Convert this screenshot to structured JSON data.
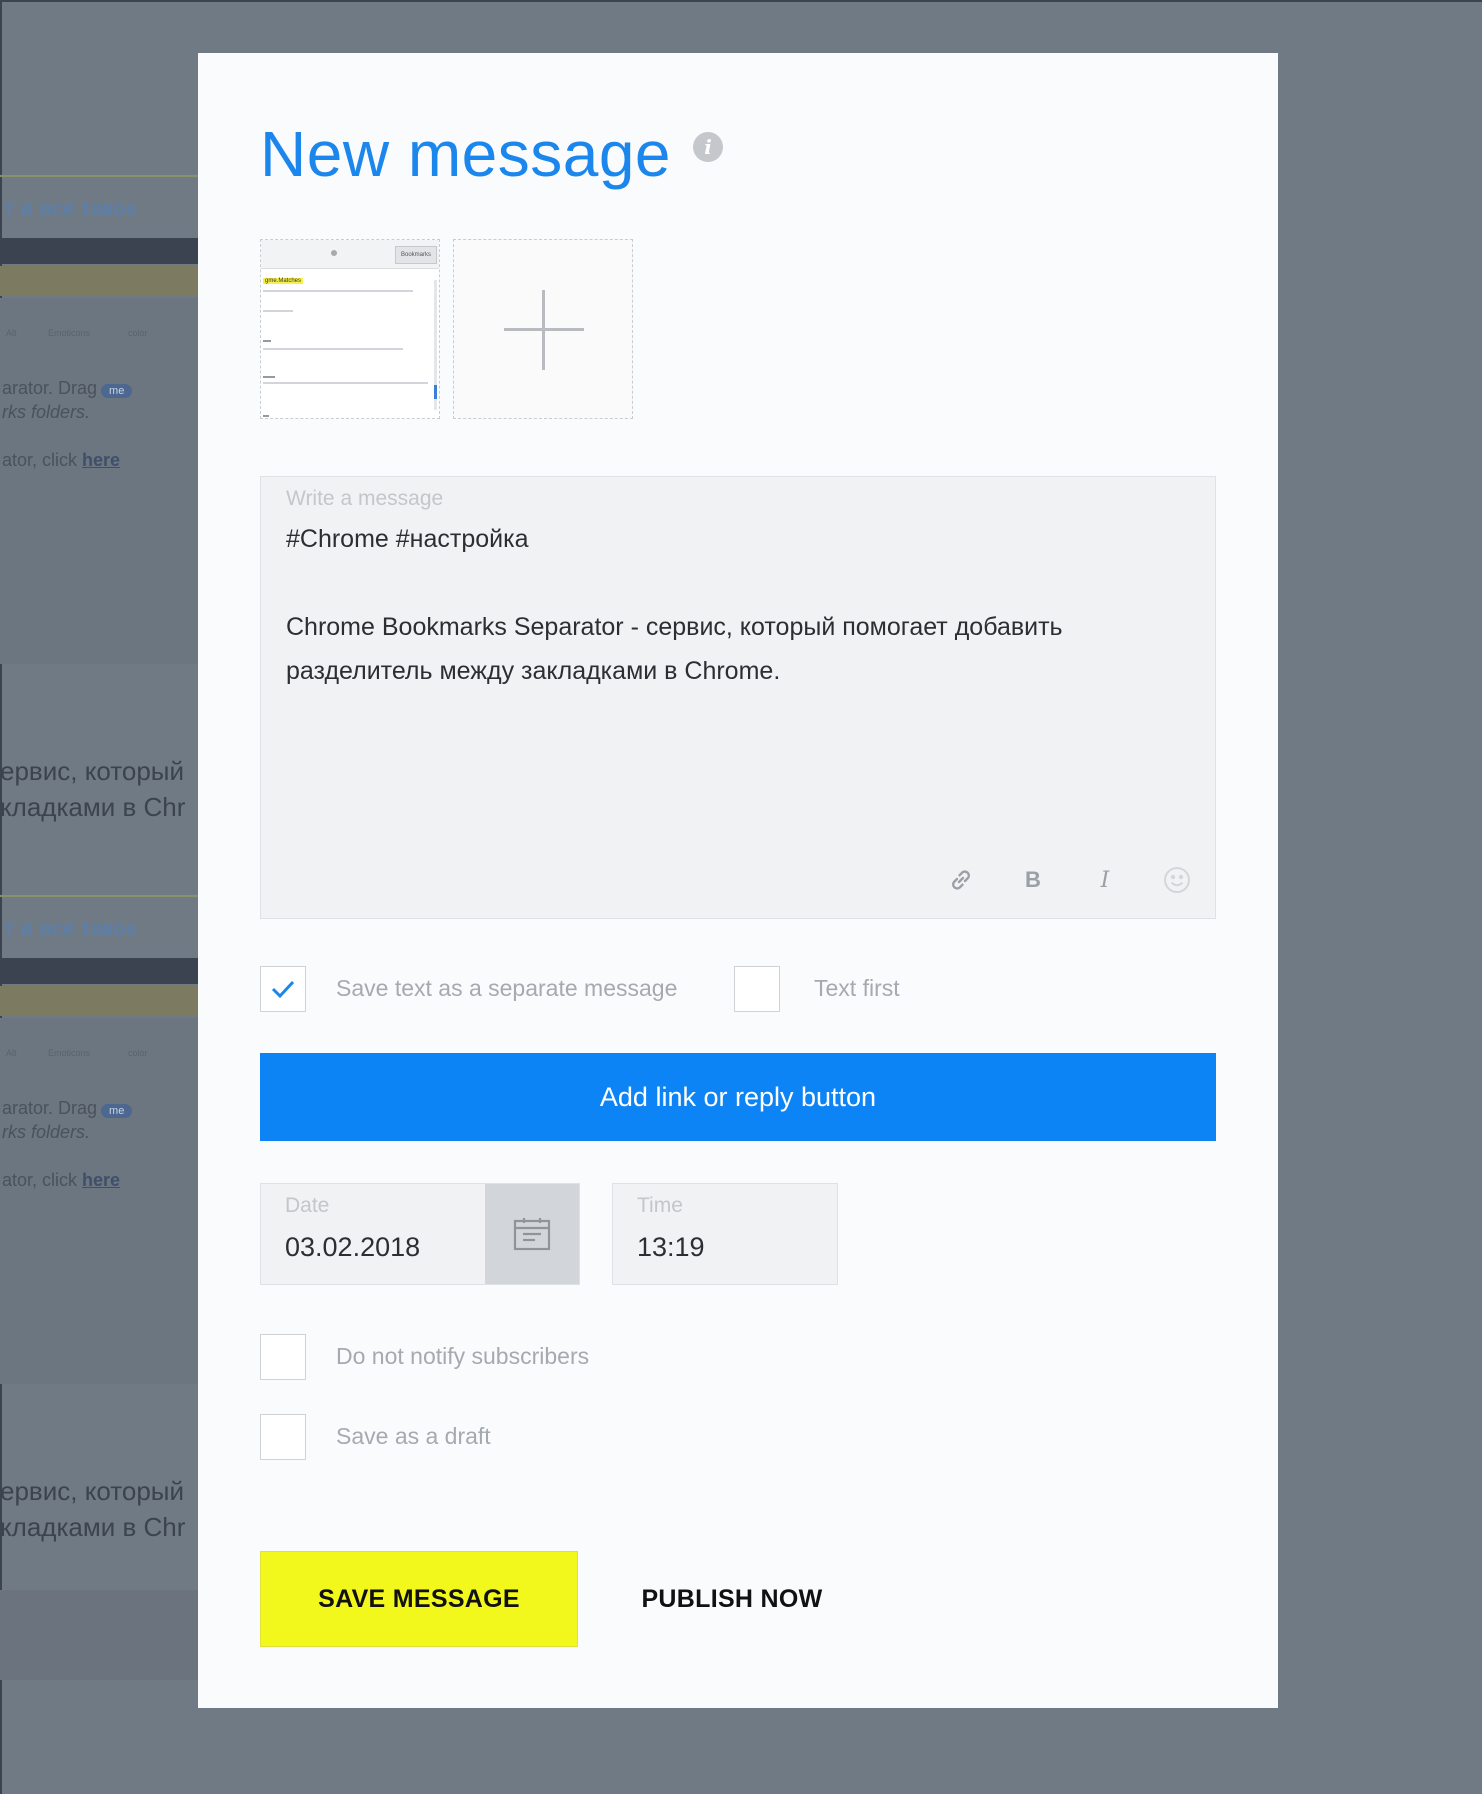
{
  "background": {
    "tagline": "т и все такое",
    "row1_text": "arator. Drag",
    "badge": "me",
    "row2_text": "rks folders.",
    "row3_text": "ator, click ",
    "row3_link": "here",
    "snippet_line1": "ервис, который",
    "snippet_line2": "кладками в Chr",
    "tiny_labels": [
      "Alt",
      "Emoticons",
      "color"
    ]
  },
  "modal": {
    "title": "New message",
    "info_icon": "i",
    "thumbnail_highlight": "gme.Matches",
    "thumbnail_button": "Bookmarks",
    "message": {
      "placeholder": "Write a message",
      "text": "#Chrome #настройка\n\nChrome Bookmarks Separator - сервис, который помогает добавить разделитель между закладками в Chrome.",
      "tools": {
        "bold": "B",
        "italic": "I"
      }
    },
    "options": {
      "separate_label": "Save text as a separate message",
      "separate_checked": true,
      "text_first_label": "Text first",
      "text_first_checked": false
    },
    "add_button_label": "Add link or reply button",
    "date": {
      "label": "Date",
      "value": "03.02.2018"
    },
    "time": {
      "label": "Time",
      "value": "13:19"
    },
    "notify_label": "Do not notify subscribers",
    "draft_label": "Save as a draft",
    "save_label": "SAVE MESSAGE",
    "publish_label": "PUBLISH NOW",
    "accent_color": "#0d84f5",
    "save_color": "#f2f71c"
  }
}
